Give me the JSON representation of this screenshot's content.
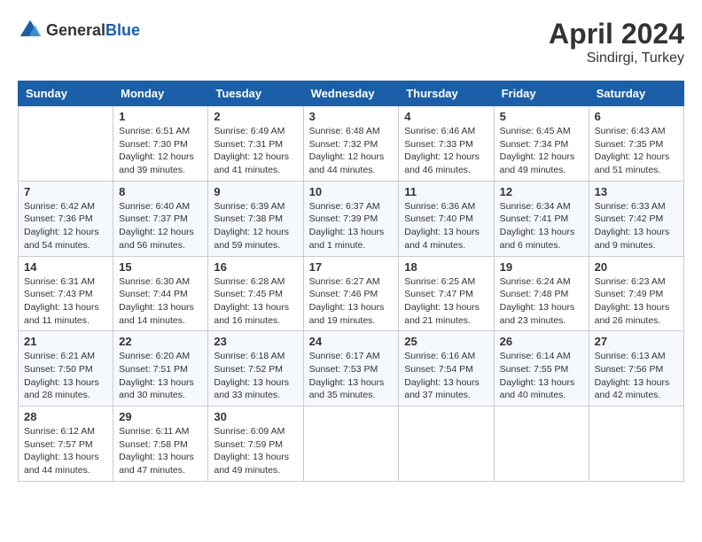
{
  "header": {
    "logo_general": "General",
    "logo_blue": "Blue",
    "month_year": "April 2024",
    "location": "Sindirgi, Turkey"
  },
  "days_of_week": [
    "Sunday",
    "Monday",
    "Tuesday",
    "Wednesday",
    "Thursday",
    "Friday",
    "Saturday"
  ],
  "weeks": [
    [
      {
        "day": "",
        "info": ""
      },
      {
        "day": "1",
        "info": "Sunrise: 6:51 AM\nSunset: 7:30 PM\nDaylight: 12 hours\nand 39 minutes."
      },
      {
        "day": "2",
        "info": "Sunrise: 6:49 AM\nSunset: 7:31 PM\nDaylight: 12 hours\nand 41 minutes."
      },
      {
        "day": "3",
        "info": "Sunrise: 6:48 AM\nSunset: 7:32 PM\nDaylight: 12 hours\nand 44 minutes."
      },
      {
        "day": "4",
        "info": "Sunrise: 6:46 AM\nSunset: 7:33 PM\nDaylight: 12 hours\nand 46 minutes."
      },
      {
        "day": "5",
        "info": "Sunrise: 6:45 AM\nSunset: 7:34 PM\nDaylight: 12 hours\nand 49 minutes."
      },
      {
        "day": "6",
        "info": "Sunrise: 6:43 AM\nSunset: 7:35 PM\nDaylight: 12 hours\nand 51 minutes."
      }
    ],
    [
      {
        "day": "7",
        "info": "Sunrise: 6:42 AM\nSunset: 7:36 PM\nDaylight: 12 hours\nand 54 minutes."
      },
      {
        "day": "8",
        "info": "Sunrise: 6:40 AM\nSunset: 7:37 PM\nDaylight: 12 hours\nand 56 minutes."
      },
      {
        "day": "9",
        "info": "Sunrise: 6:39 AM\nSunset: 7:38 PM\nDaylight: 12 hours\nand 59 minutes."
      },
      {
        "day": "10",
        "info": "Sunrise: 6:37 AM\nSunset: 7:39 PM\nDaylight: 13 hours\nand 1 minute."
      },
      {
        "day": "11",
        "info": "Sunrise: 6:36 AM\nSunset: 7:40 PM\nDaylight: 13 hours\nand 4 minutes."
      },
      {
        "day": "12",
        "info": "Sunrise: 6:34 AM\nSunset: 7:41 PM\nDaylight: 13 hours\nand 6 minutes."
      },
      {
        "day": "13",
        "info": "Sunrise: 6:33 AM\nSunset: 7:42 PM\nDaylight: 13 hours\nand 9 minutes."
      }
    ],
    [
      {
        "day": "14",
        "info": "Sunrise: 6:31 AM\nSunset: 7:43 PM\nDaylight: 13 hours\nand 11 minutes."
      },
      {
        "day": "15",
        "info": "Sunrise: 6:30 AM\nSunset: 7:44 PM\nDaylight: 13 hours\nand 14 minutes."
      },
      {
        "day": "16",
        "info": "Sunrise: 6:28 AM\nSunset: 7:45 PM\nDaylight: 13 hours\nand 16 minutes."
      },
      {
        "day": "17",
        "info": "Sunrise: 6:27 AM\nSunset: 7:46 PM\nDaylight: 13 hours\nand 19 minutes."
      },
      {
        "day": "18",
        "info": "Sunrise: 6:25 AM\nSunset: 7:47 PM\nDaylight: 13 hours\nand 21 minutes."
      },
      {
        "day": "19",
        "info": "Sunrise: 6:24 AM\nSunset: 7:48 PM\nDaylight: 13 hours\nand 23 minutes."
      },
      {
        "day": "20",
        "info": "Sunrise: 6:23 AM\nSunset: 7:49 PM\nDaylight: 13 hours\nand 26 minutes."
      }
    ],
    [
      {
        "day": "21",
        "info": "Sunrise: 6:21 AM\nSunset: 7:50 PM\nDaylight: 13 hours\nand 28 minutes."
      },
      {
        "day": "22",
        "info": "Sunrise: 6:20 AM\nSunset: 7:51 PM\nDaylight: 13 hours\nand 30 minutes."
      },
      {
        "day": "23",
        "info": "Sunrise: 6:18 AM\nSunset: 7:52 PM\nDaylight: 13 hours\nand 33 minutes."
      },
      {
        "day": "24",
        "info": "Sunrise: 6:17 AM\nSunset: 7:53 PM\nDaylight: 13 hours\nand 35 minutes."
      },
      {
        "day": "25",
        "info": "Sunrise: 6:16 AM\nSunset: 7:54 PM\nDaylight: 13 hours\nand 37 minutes."
      },
      {
        "day": "26",
        "info": "Sunrise: 6:14 AM\nSunset: 7:55 PM\nDaylight: 13 hours\nand 40 minutes."
      },
      {
        "day": "27",
        "info": "Sunrise: 6:13 AM\nSunset: 7:56 PM\nDaylight: 13 hours\nand 42 minutes."
      }
    ],
    [
      {
        "day": "28",
        "info": "Sunrise: 6:12 AM\nSunset: 7:57 PM\nDaylight: 13 hours\nand 44 minutes."
      },
      {
        "day": "29",
        "info": "Sunrise: 6:11 AM\nSunset: 7:58 PM\nDaylight: 13 hours\nand 47 minutes."
      },
      {
        "day": "30",
        "info": "Sunrise: 6:09 AM\nSunset: 7:59 PM\nDaylight: 13 hours\nand 49 minutes."
      },
      {
        "day": "",
        "info": ""
      },
      {
        "day": "",
        "info": ""
      },
      {
        "day": "",
        "info": ""
      },
      {
        "day": "",
        "info": ""
      }
    ]
  ]
}
